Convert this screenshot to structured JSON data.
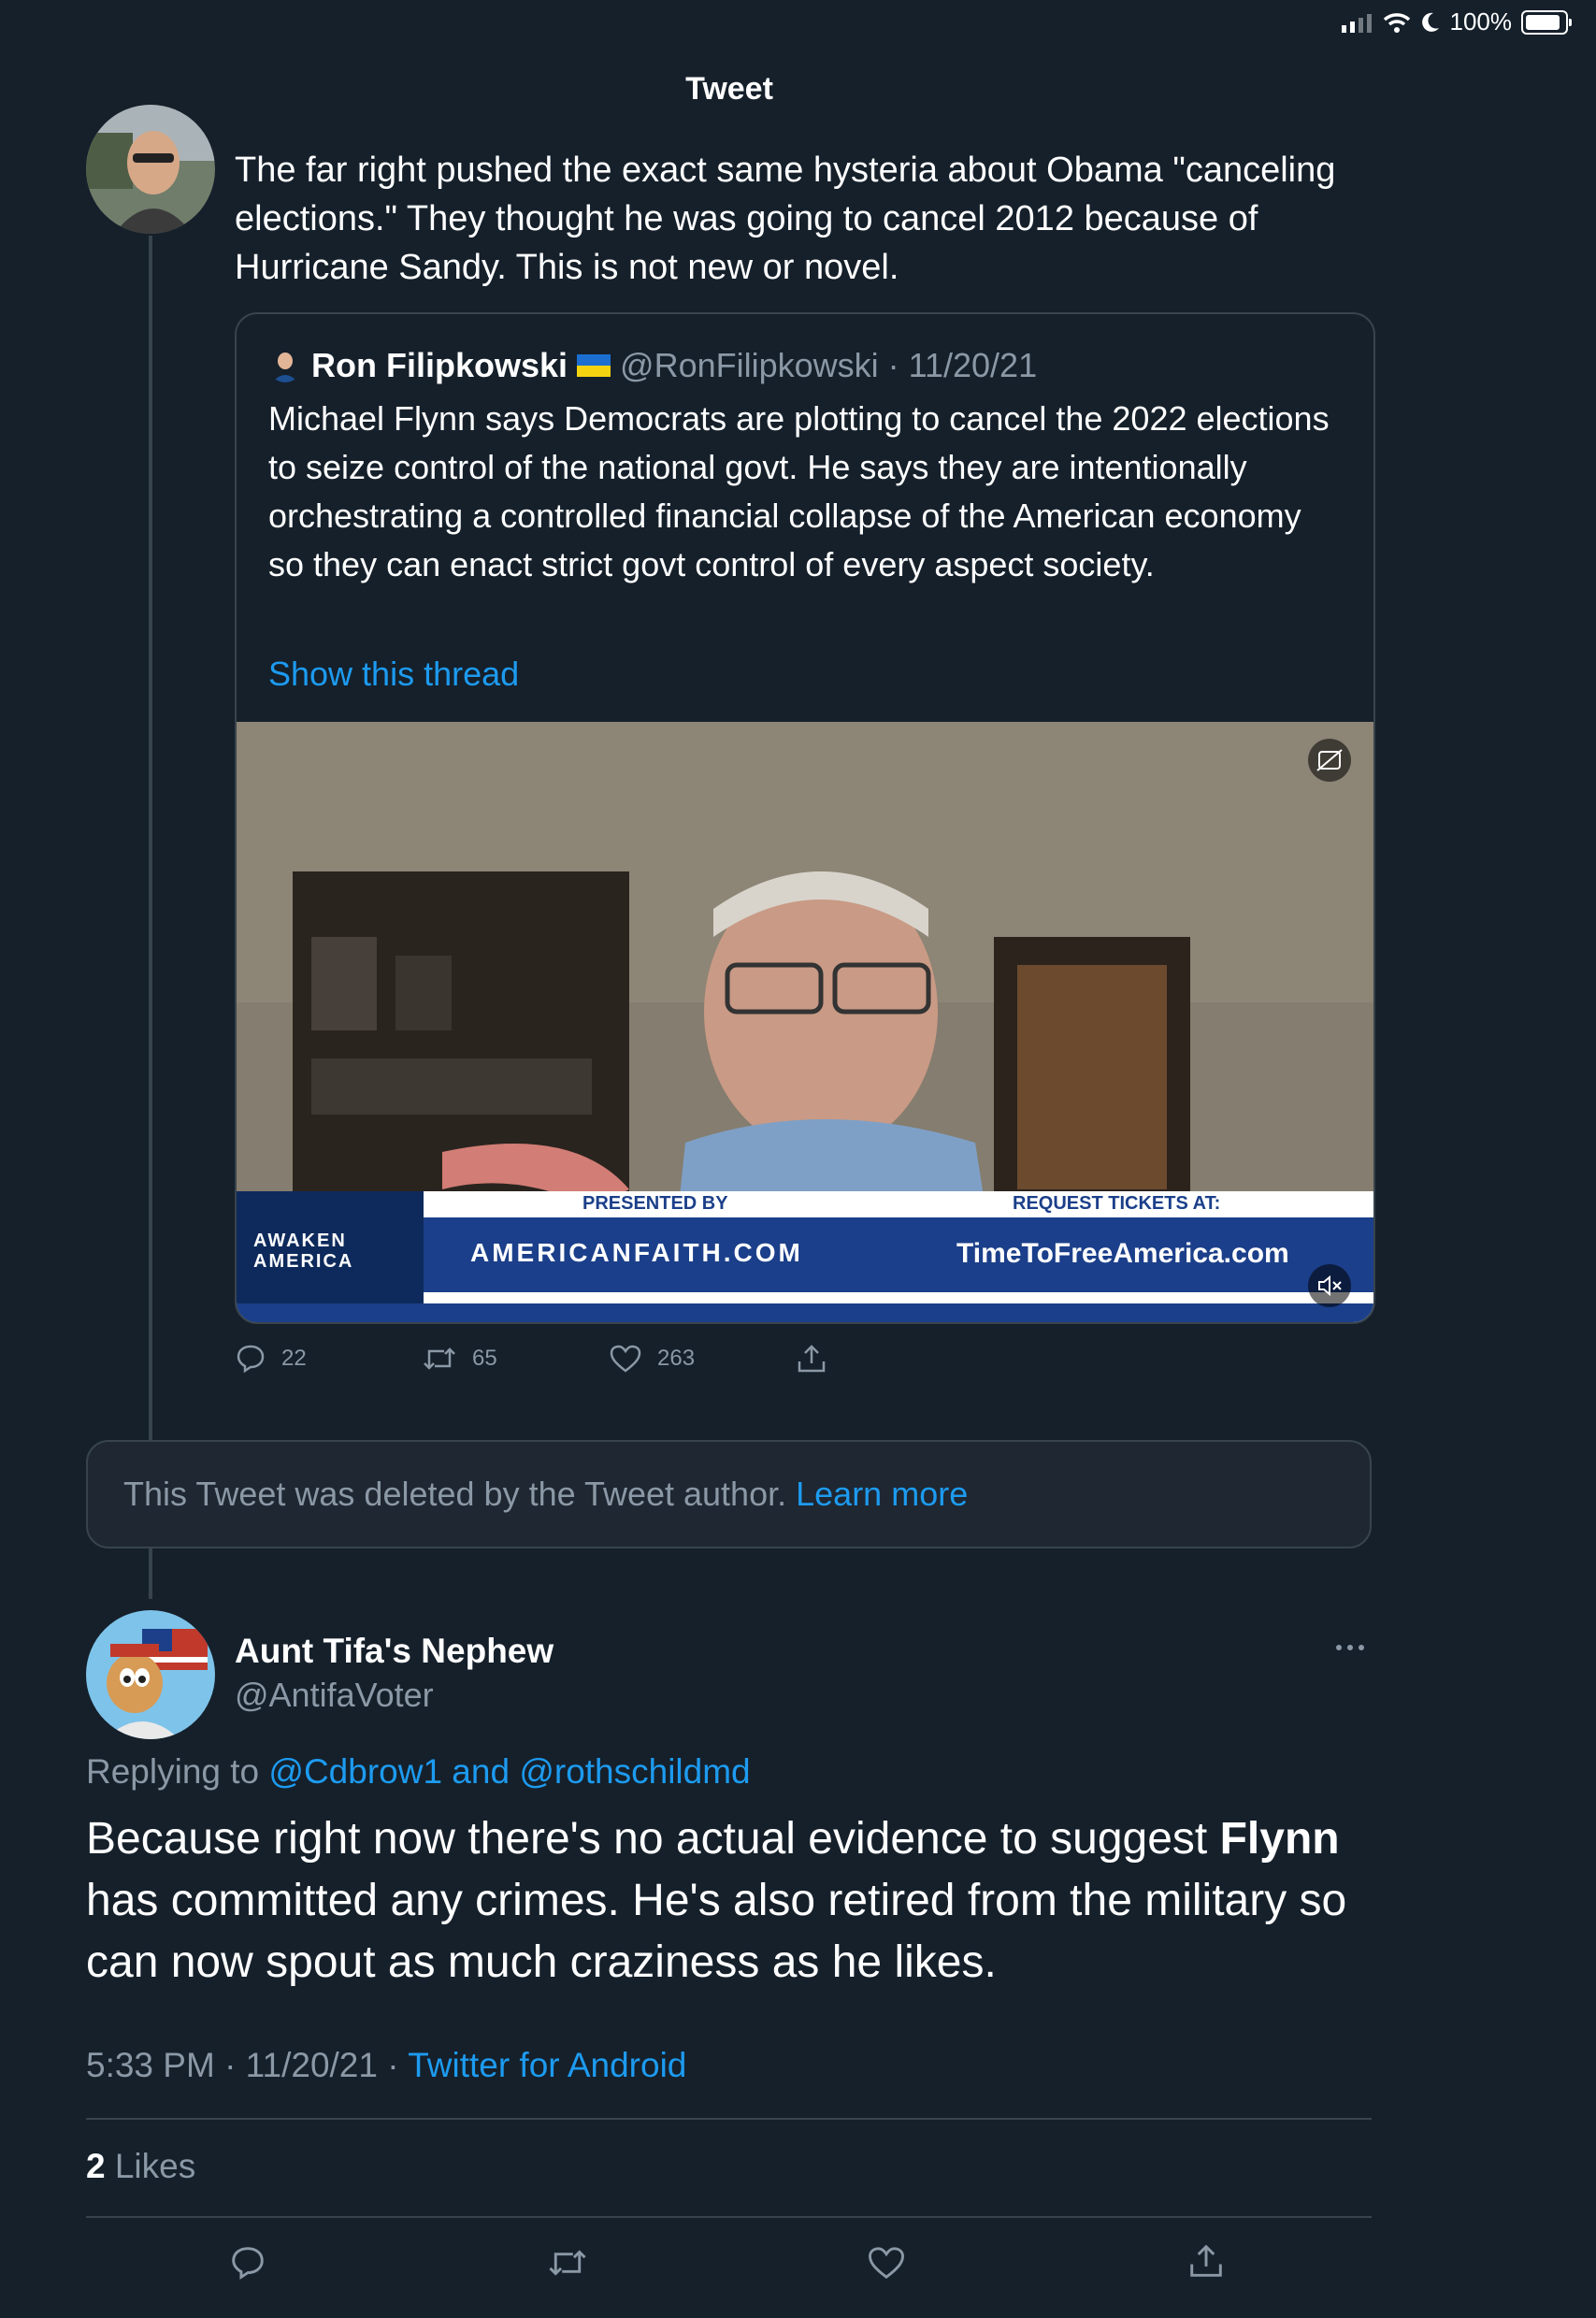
{
  "status_bar": {
    "battery_text": "100%",
    "battery_level": 1.0
  },
  "header": {
    "title": "Tweet"
  },
  "parent_tweet": {
    "text": "The far right pushed the exact same hysteria about Obama \"canceling elections.\" They thought he was going to cancel 2012 because of Hurricane Sandy. This is not new or novel.",
    "quoted": {
      "name": "Ron Filipkowski",
      "handle": "@RonFilipkowski",
      "date": "· 11/20/21",
      "text": "Michael Flynn says Democrats are plotting to cancel the 2022 elections to seize control of the national govt. He says they are intentionally orchestrating a controlled financial collapse of the American economy so they can enact strict govt control of every aspect society.",
      "show_thread": "Show this thread",
      "video": {
        "banner_left": "AWAKEN AMERICA",
        "presented_by": "PRESENTED BY",
        "request_tickets": "REQUEST TICKETS AT:",
        "sponsor": "AMERICANFAITH.COM",
        "sponsor_url": "TimeToFreeAmerica.com"
      }
    },
    "actions": {
      "replies": "22",
      "retweets": "65",
      "likes": "263"
    }
  },
  "deleted_notice": {
    "text": "This Tweet was deleted by the Tweet author.",
    "link": "Learn more"
  },
  "main_tweet": {
    "name": "Aunt Tifa's Nephew",
    "handle": "@AntifaVoter",
    "replying_prefix": "Replying to",
    "replying_to": "@Cdbrow1 and @rothschildmd",
    "text_part1": "Because right now there's no actual evidence to suggest",
    "text_bold": "Flynn",
    "text_part2": "has committed any crimes. He's also retired from the military so can now spout as much craziness as he likes.",
    "time": "5:33 PM · 11/20/21 ·",
    "source": "Twitter for Android",
    "likes_count": "2",
    "likes_label": "Likes"
  },
  "colors": {
    "background": "#15202b",
    "accent": "#1d9bf0",
    "muted": "#8b98a5",
    "border": "#38444d"
  }
}
